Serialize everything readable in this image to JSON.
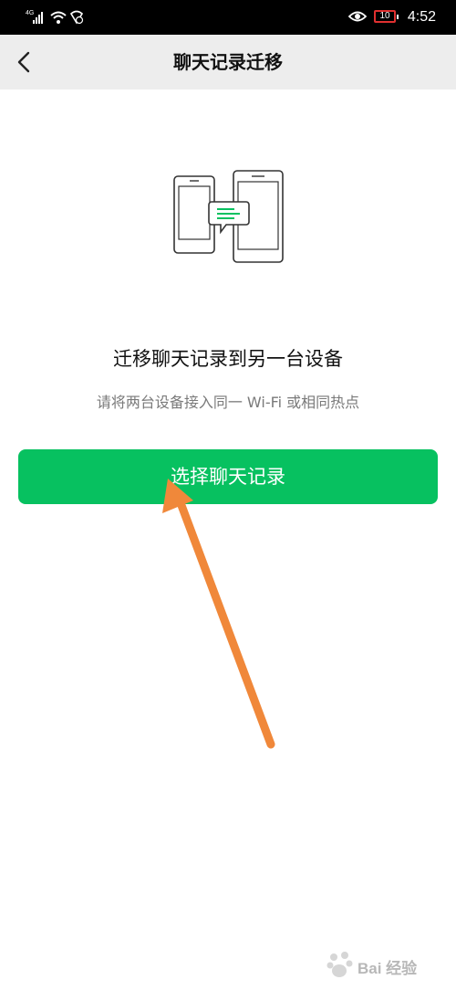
{
  "status_bar": {
    "network": "4G",
    "battery_level": "10",
    "time": "4:52"
  },
  "nav": {
    "title": "聊天记录迁移",
    "back_icon": "chevron-left-icon"
  },
  "illustration": {
    "icon": "phone-transfer-icon",
    "accent_color": "#07c160"
  },
  "main": {
    "heading": "迁移聊天记录到另一台设备",
    "subtext": "请将两台设备接入同一 Wi-Fi 或相同热点",
    "button_label": "选择聊天记录",
    "button_color": "#07c160"
  },
  "annotation": {
    "arrow_color": "#f0883a"
  },
  "watermark": {
    "text": "Bai 经验"
  }
}
